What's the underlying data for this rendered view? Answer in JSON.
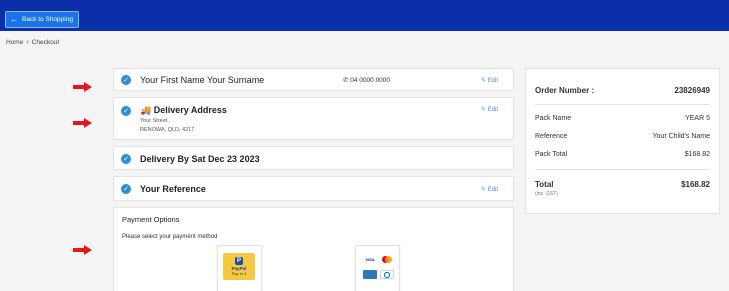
{
  "header": {
    "back_label": "Back to Shopping"
  },
  "breadcrumb": {
    "home": "Home",
    "current": "Checkout"
  },
  "contact": {
    "name": "Your First Name Your Surname",
    "phone": "04 0000 0000",
    "edit_label": "Edit"
  },
  "delivery_address": {
    "title": "Delivery Address",
    "street": "Your Street ,",
    "city": "RENOWA, QLD, 4217",
    "edit_label": "Edit"
  },
  "delivery_date": {
    "title": "Delivery By Sat Dec 23 2023"
  },
  "reference": {
    "title": "Your Reference",
    "edit_label": "Edit"
  },
  "payment": {
    "title": "Payment Options",
    "prompt": "Please select your payment method",
    "paypal_brand": "PayPal",
    "paypal_sub": "Pay in 4",
    "cards": [
      "VISA",
      "MC",
      "AMEX",
      "DINERS"
    ]
  },
  "summary": {
    "order_label": "Order Number :",
    "order_value": "23826949",
    "pack_name_label": "Pack Name",
    "pack_name_value": "YEAR 5",
    "reference_label": "Reference",
    "reference_value": "Your Child's Name",
    "pack_total_label": "Pack Total",
    "pack_total_value": "$168.82",
    "total_label": "Total",
    "total_sub": "(inc. GST)",
    "total_value": "$168.82"
  },
  "colors": {
    "header_bg": "#0a2fa8",
    "accent": "#2a8fd6",
    "arrow": "#e8161b"
  }
}
